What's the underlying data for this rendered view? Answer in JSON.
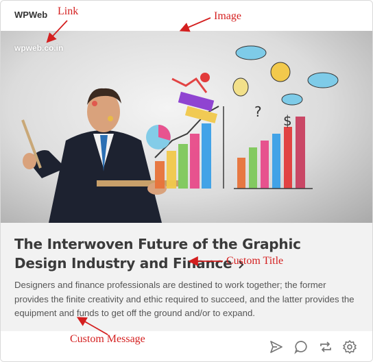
{
  "card": {
    "site_name": "WPWeb",
    "image": {
      "watermark": "wpweb.co.in"
    },
    "title": "The Interwoven Future of the Graphic Design Industry and Finance",
    "message": "Designers and finance professionals are destined to work together; the former provides the finite creativity and ethic required to succeed, and the latter provides the equipment and funds to get off the ground and/or to expand."
  },
  "actions": [
    {
      "icon": "send-icon"
    },
    {
      "icon": "comment-icon"
    },
    {
      "icon": "repost-icon"
    },
    {
      "icon": "gear-icon"
    }
  ],
  "annotations": {
    "link": "Link",
    "image": "Image",
    "custom_title": "Custom Title",
    "custom_message": "Custom Message"
  },
  "colors": {
    "annotation": "#d41f1f",
    "title": "#3a3a3a",
    "message": "#555555",
    "body_bg": "#f2f2f2"
  }
}
